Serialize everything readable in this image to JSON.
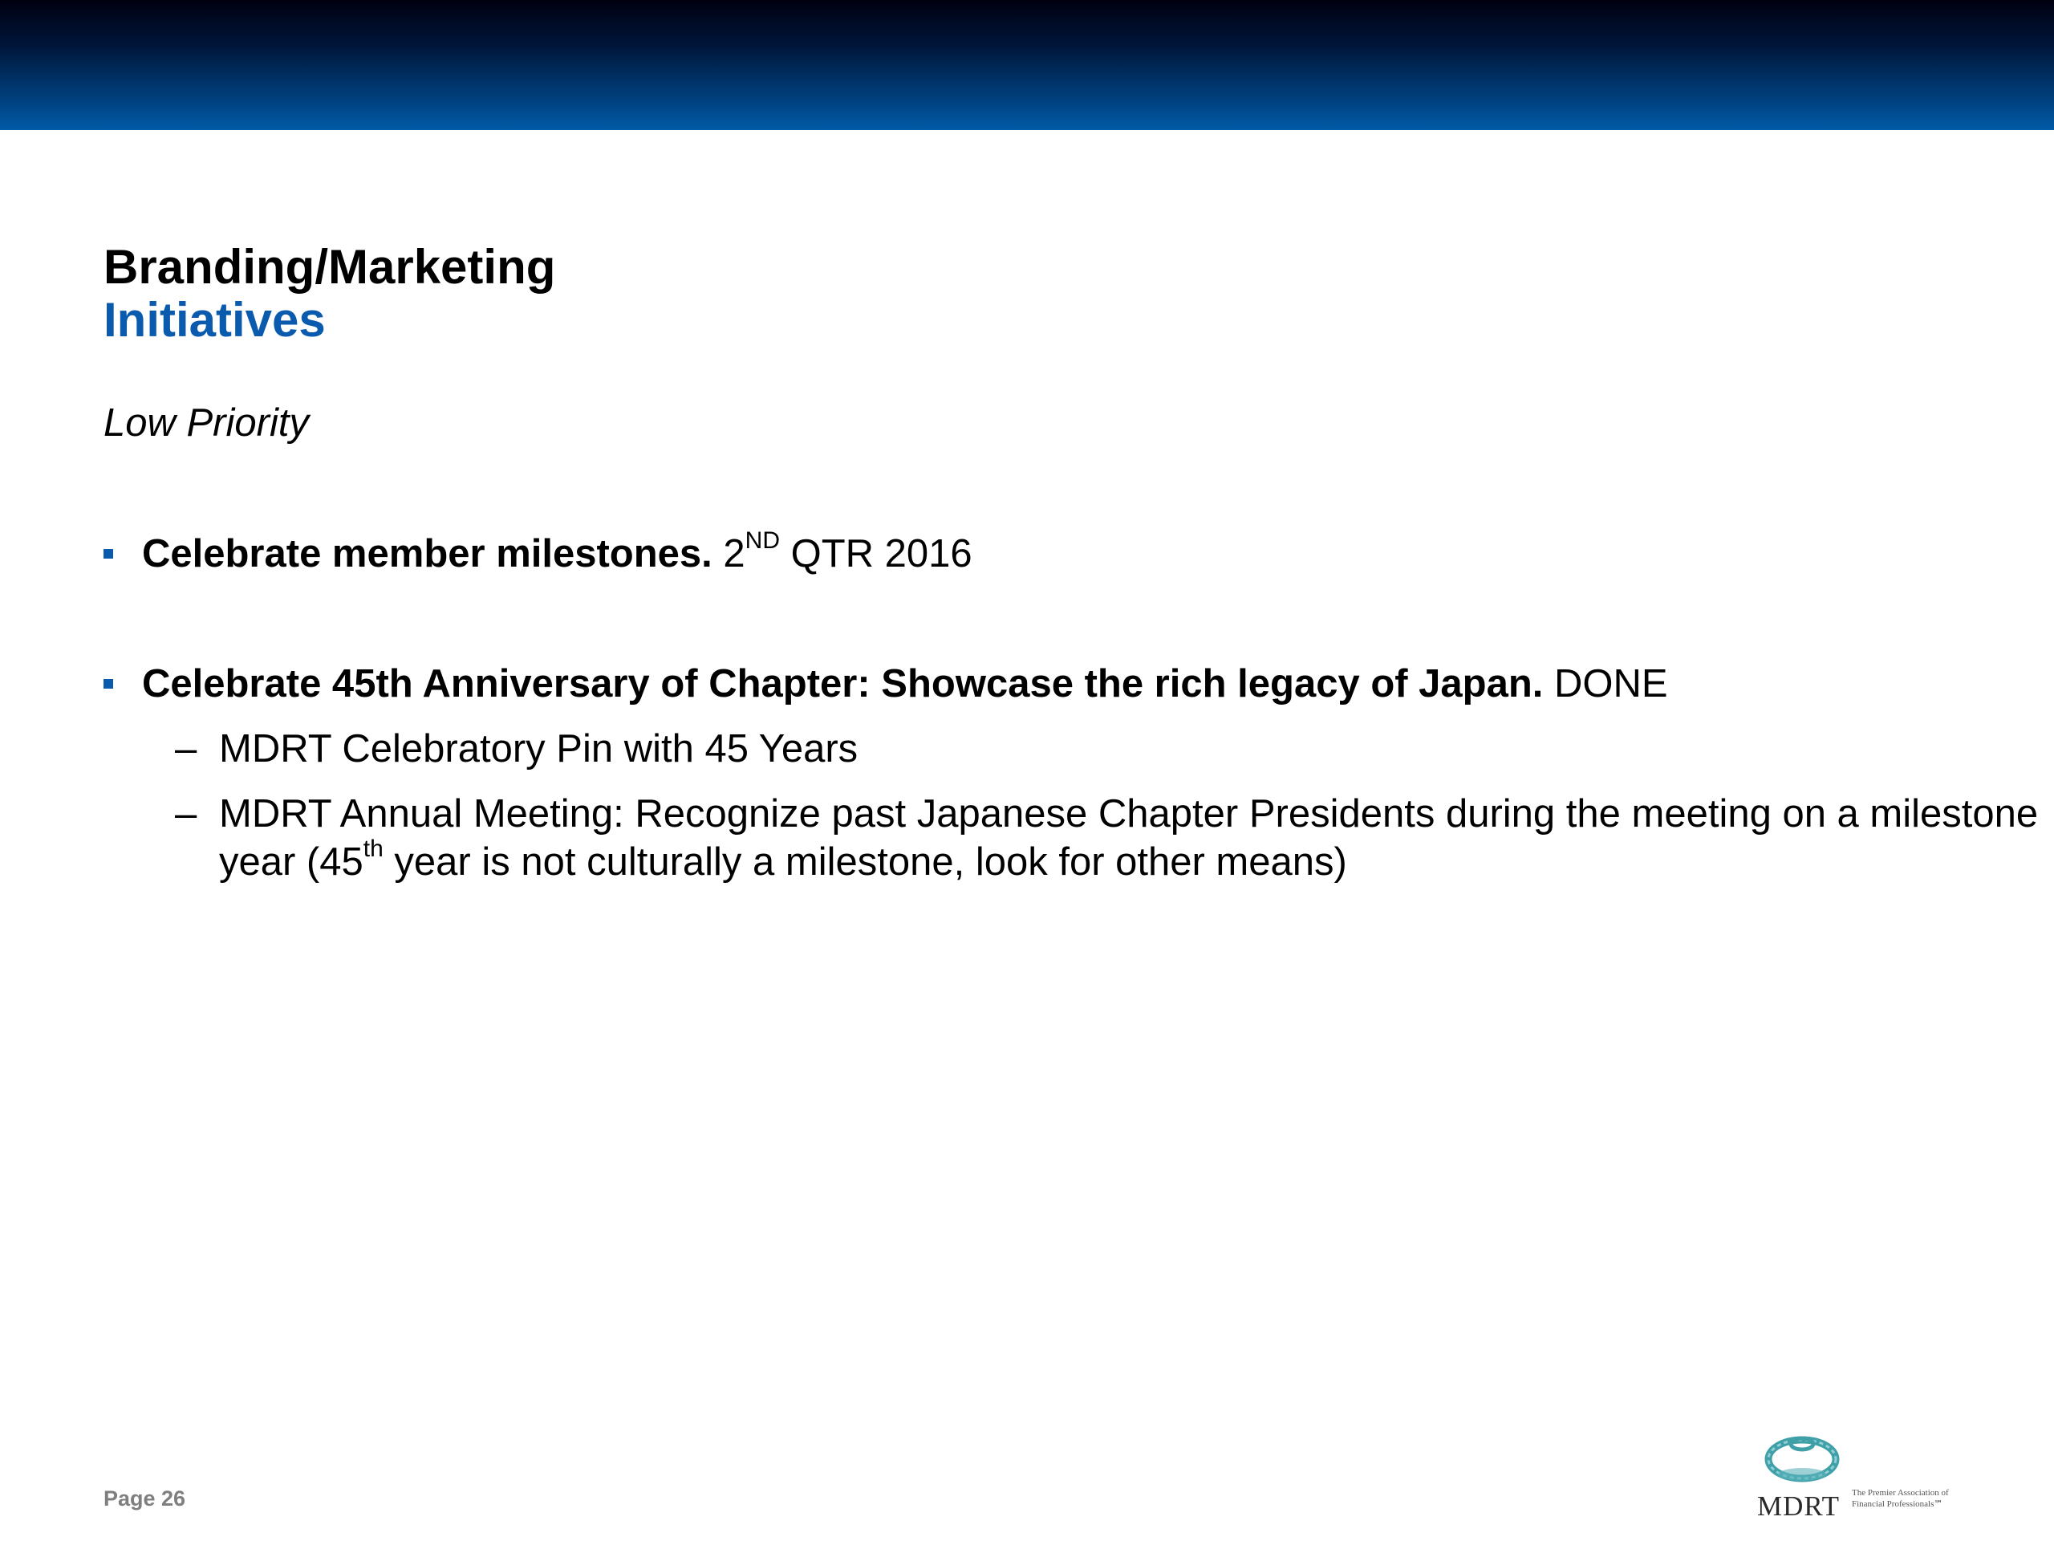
{
  "slide": {
    "title_line1": "Branding/Marketing",
    "title_line2": "Initiatives",
    "priority": "Low Priority",
    "bullets": [
      {
        "bold": "Celebrate member milestones.",
        "rest_prefix": " 2",
        "rest_sup": "ND",
        "rest_suffix": " QTR 2016"
      },
      {
        "bold": "Celebrate 45th Anniversary of Chapter: Showcase the rich legacy of Japan.",
        "rest": " DONE",
        "sub_items": [
          {
            "dash": "–",
            "text": "MDRT Celebratory Pin with 45 Years"
          },
          {
            "dash": "–",
            "text_prefix": "MDRT Annual Meeting: Recognize past Japanese Chapter Presidents during the meeting on a milestone year (45",
            "text_sup": "th",
            "text_suffix": " year is not culturally a milestone, look for other means)"
          }
        ]
      }
    ]
  },
  "footer": {
    "page_label": "Page 26",
    "logo_text": "MDRT",
    "logo_tagline": "The Premier Association of Financial Professionals℠"
  },
  "colors": {
    "accent_blue": "#0a5aad",
    "header_dark": "#000010",
    "header_light": "#005aa6"
  }
}
